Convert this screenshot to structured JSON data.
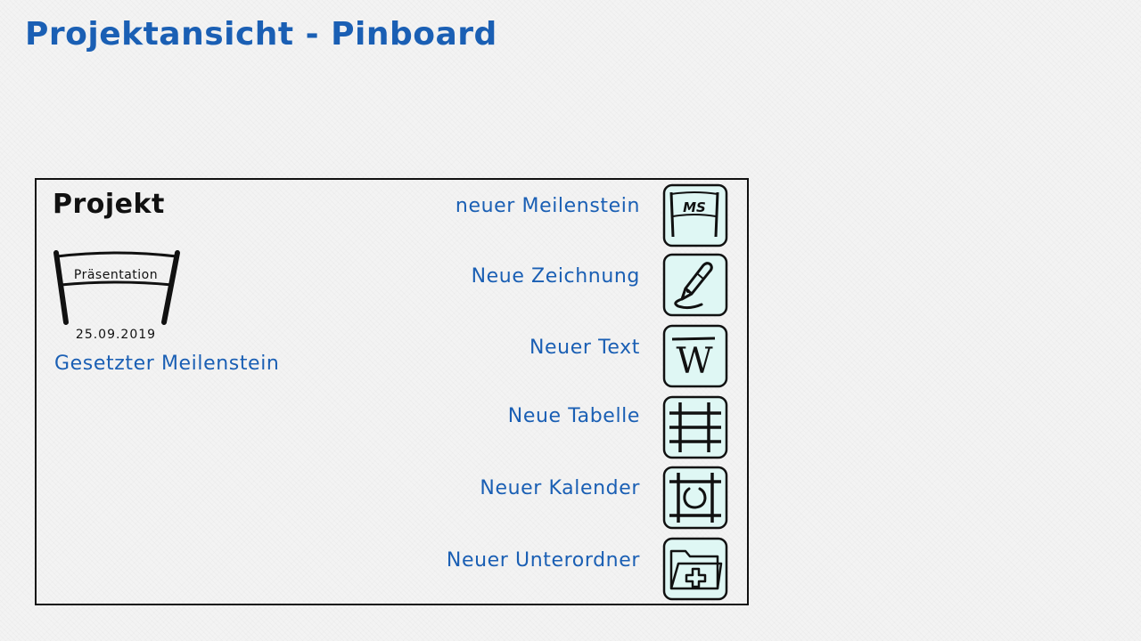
{
  "page": {
    "title": "Projektansicht - Pinboard"
  },
  "board": {
    "heading": "Projekt",
    "milestone": {
      "name": "Präsentation",
      "date": "25.09.2019",
      "caption": "Gesetzter Meilenstein",
      "icon": "milestone-flag-icon"
    },
    "actions": [
      {
        "label": "neuer Meilenstein",
        "icon": "milestone-icon",
        "icon_text": "MS"
      },
      {
        "label": "Neue Zeichnung",
        "icon": "pen-icon"
      },
      {
        "label": "Neuer Text",
        "icon": "text-icon",
        "icon_text": "W"
      },
      {
        "label": "Neue Tabelle",
        "icon": "table-icon"
      },
      {
        "label": "Neuer Kalender",
        "icon": "calendar-icon"
      },
      {
        "label": "Neuer Unterordner",
        "icon": "folder-add-icon"
      }
    ]
  },
  "colors": {
    "accent": "#1a5fb4",
    "icon_fill": "#dff7f4",
    "ink": "#111111"
  }
}
